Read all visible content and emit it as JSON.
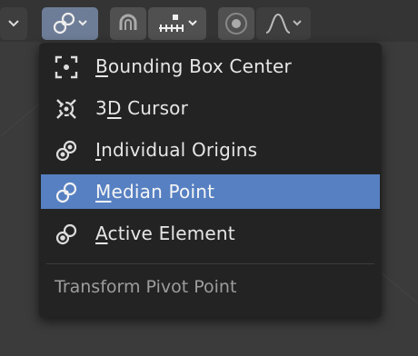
{
  "header": {
    "pivot_button": {
      "icon": "median-point-pivot-icon",
      "active": true
    },
    "snap_button": {
      "icon": "snap-magnet-icon"
    },
    "snap_target": {
      "icon": "snap-increment-icon"
    },
    "proportional_button": {
      "icon": "proportional-edit-icon"
    },
    "falloff_button": {
      "icon": "falloff-curve-icon"
    }
  },
  "menu": {
    "items": [
      {
        "label_ul": "B",
        "label_rest": "ounding Box Center",
        "icon": "bounding-box-center-icon",
        "selected": false
      },
      {
        "label_pre": "3",
        "label_ul": "D",
        "label_rest": " Cursor",
        "icon": "3d-cursor-icon",
        "selected": false
      },
      {
        "label_ul": "I",
        "label_rest": "ndividual Origins",
        "icon": "individual-origins-icon",
        "selected": false
      },
      {
        "label_ul": "M",
        "label_rest": "edian Point",
        "icon": "median-point-icon",
        "selected": true
      },
      {
        "label_ul": "A",
        "label_rest": "ctive Element",
        "icon": "active-element-icon",
        "selected": false
      }
    ],
    "footer": "Transform Pivot Point"
  },
  "colors": {
    "menu_bg": "#232323",
    "selected": "#5680c2",
    "text": "#e6e6e6",
    "footer_text": "#9d9d9d",
    "active_button": "#6e7d97"
  }
}
